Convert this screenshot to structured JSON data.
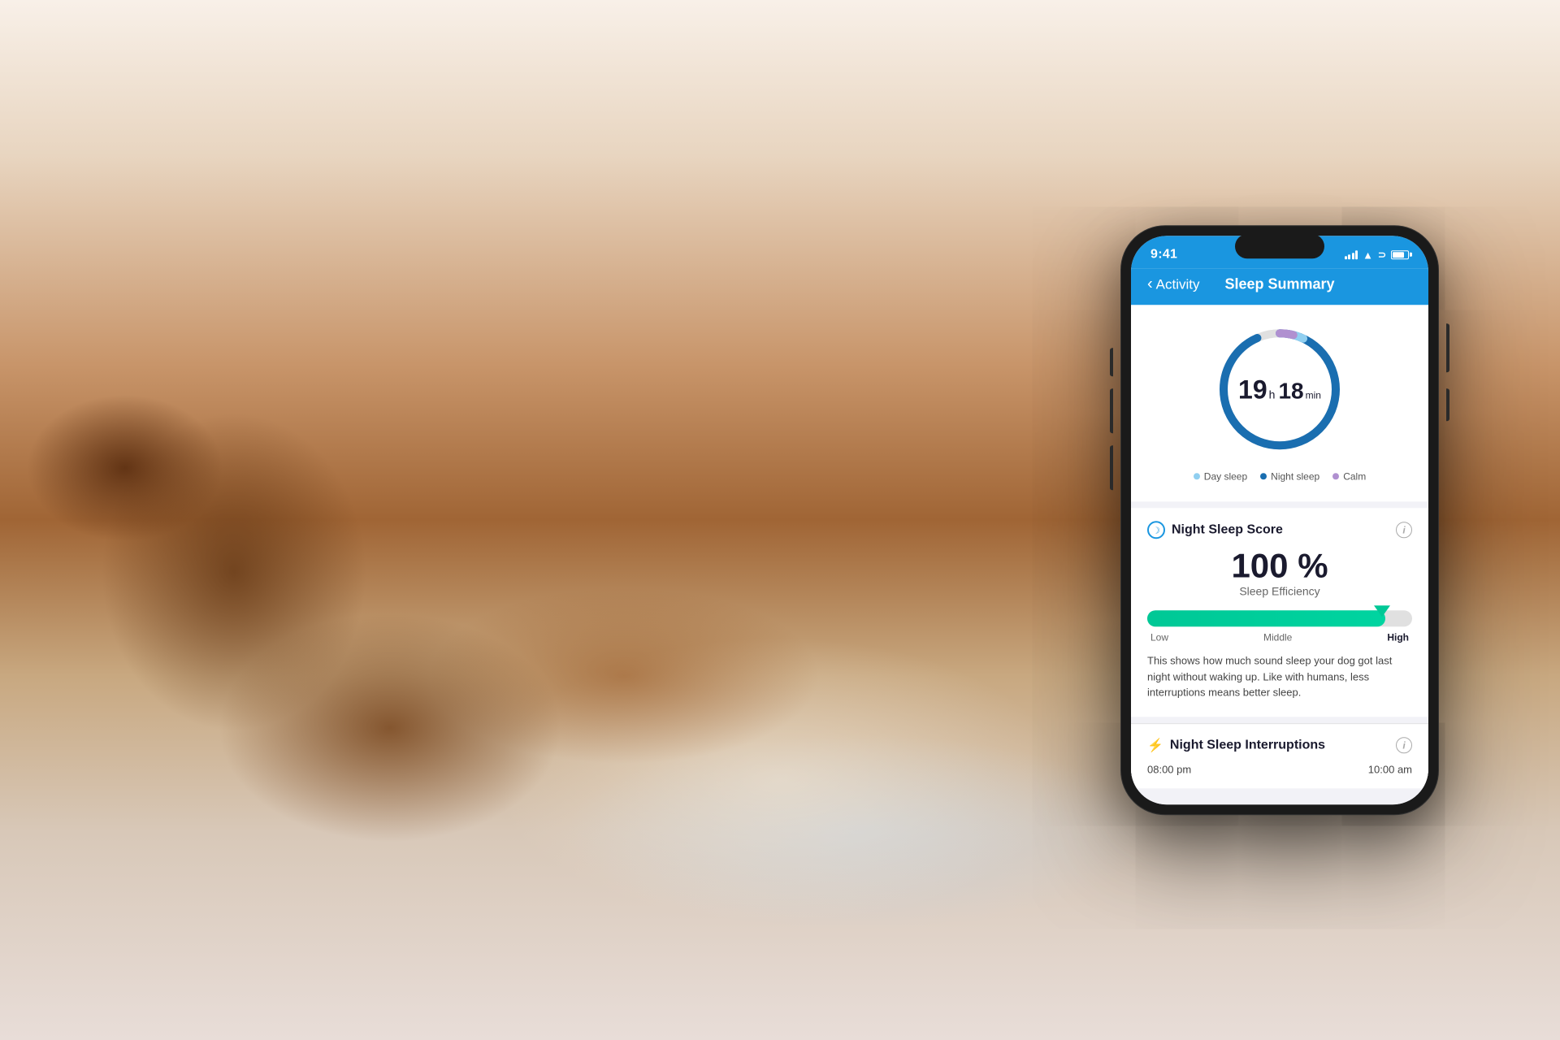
{
  "background": {
    "alt": "Sleeping dog on a bed"
  },
  "status_bar": {
    "time": "9:41",
    "signal": "signal-bars",
    "wifi": "wifi",
    "battery": "battery"
  },
  "nav": {
    "back_label": "Activity",
    "title": "Sleep Summary"
  },
  "sleep_circle": {
    "hours": "19",
    "h_unit": "h",
    "minutes": "18",
    "min_unit": "min"
  },
  "legend": {
    "items": [
      {
        "label": "Day sleep",
        "color": "#90cff0"
      },
      {
        "label": "Night sleep",
        "color": "#1a6eb0"
      },
      {
        "label": "Calm",
        "color": "#b090d0"
      }
    ]
  },
  "night_sleep_score": {
    "title": "Night Sleep Score",
    "icon": "moon-icon",
    "score": "100 %",
    "score_sublabel": "Sleep Efficiency",
    "progress_labels": {
      "low": "Low",
      "middle": "Middle",
      "high": "High"
    },
    "description": "This shows how much sound sleep your dog got last night without waking up. Like with humans, less interruptions means better sleep."
  },
  "night_sleep_interruptions": {
    "title": "Night Sleep Interruptions",
    "icon": "lightning-icon",
    "start_time": "08:00 pm",
    "end_time": "10:00 am"
  }
}
